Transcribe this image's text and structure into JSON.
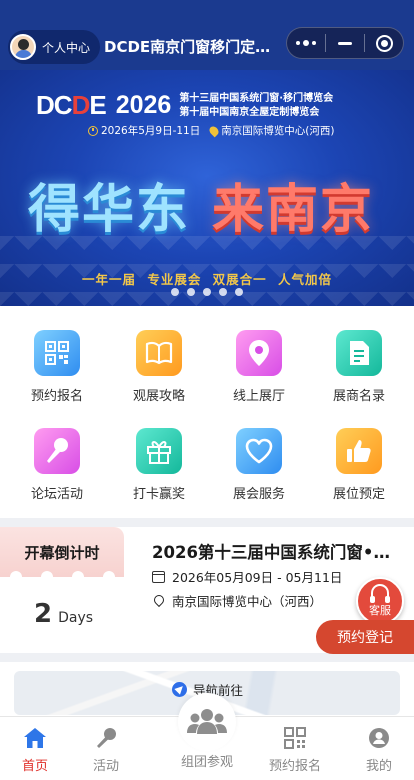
{
  "header": {
    "user_label": "个人中心",
    "title": "DCDE南京门窗移门定…"
  },
  "banner": {
    "logo_main": "DC",
    "logo_accent": "D",
    "logo_tail": "E",
    "year": "2026",
    "line1": "第十三届中国系统门窗·移门博览会",
    "line2": "第十届中国南京全屋定制博览会",
    "date": "2026年5月9日-11日",
    "venue": "南京国际博览中心(河西)",
    "slogan_left": "得华东",
    "slogan_right": "来南京",
    "tagline": "一年一届 专业展会 双展合一 人气加倍",
    "slide_count": 5
  },
  "menu": {
    "items": [
      {
        "label": "预约报名",
        "icon": "qr-code-icon",
        "color": "#2f8df0"
      },
      {
        "label": "观展攻略",
        "icon": "book-icon",
        "color": "#ff9a1f"
      },
      {
        "label": "线上展厅",
        "icon": "location-pin-icon",
        "color": "#d84ee6"
      },
      {
        "label": "展商名录",
        "icon": "document-icon",
        "color": "#14b89b"
      },
      {
        "label": "论坛活动",
        "icon": "microphone-icon",
        "color": "#d84ee6"
      },
      {
        "label": "打卡赢奖",
        "icon": "gift-icon",
        "color": "#14b89b"
      },
      {
        "label": "展会服务",
        "icon": "heart-icon",
        "color": "#2f8df0"
      },
      {
        "label": "展位预定",
        "icon": "thumbs-up-icon",
        "color": "#ff9a1f"
      }
    ]
  },
  "expo": {
    "countdown_title": "开幕倒计时",
    "countdown_value": "2",
    "countdown_unit": "Days",
    "title": "2026第十三届中国系统门窗•…",
    "date_range": "2026年05月09日 - 05月11日",
    "venue": "南京国际博览中心（河西）",
    "support_label": "客服",
    "register_label": "预约登记"
  },
  "map": {
    "nav_label": "导航前往"
  },
  "tabbar": {
    "tabs": [
      {
        "label": "首页",
        "icon": "home-icon",
        "active": true
      },
      {
        "label": "活动",
        "icon": "microphone-icon",
        "active": false
      },
      {
        "label": "组团参观",
        "icon": "group-icon",
        "active": false
      },
      {
        "label": "预约报名",
        "icon": "qr-code-icon",
        "active": false
      },
      {
        "label": "我的",
        "icon": "user-icon",
        "active": false
      }
    ]
  },
  "colors": {
    "brand_blue": "#1b3a8f",
    "accent_red": "#e0302a",
    "register_red": "#d5472f",
    "tagline_gold": "#f2c74a"
  }
}
